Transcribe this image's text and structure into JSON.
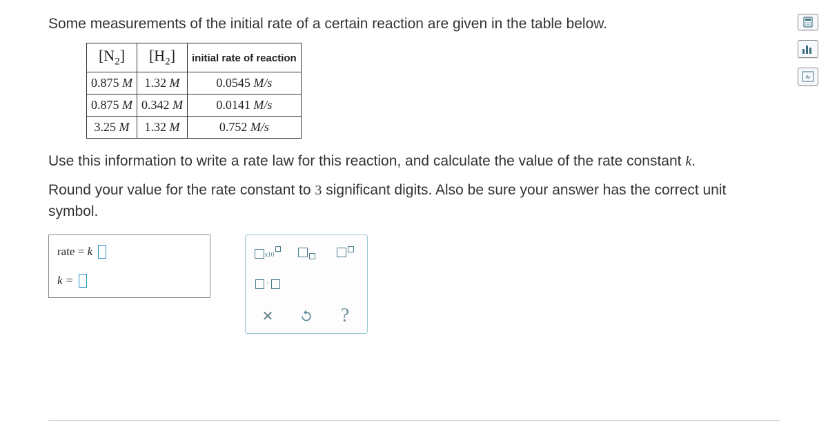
{
  "intro_text": "Some measurements of the initial rate of a certain reaction are given in the table below.",
  "table": {
    "headers": {
      "col1_element": "N",
      "col1_sub": "2",
      "col2_element": "H",
      "col2_sub": "2",
      "col3": "initial rate of reaction"
    },
    "rows": [
      {
        "n2": "0.875",
        "h2": "1.32",
        "rate": "0.0545",
        "unit_m": "M",
        "rate_unit": "M/s"
      },
      {
        "n2": "0.875",
        "h2": "0.342",
        "rate": "0.0141",
        "unit_m": "M",
        "rate_unit": "M/s"
      },
      {
        "n2": "3.25",
        "h2": "1.32",
        "rate": "0.752",
        "unit_m": "M",
        "rate_unit": "M/s"
      }
    ]
  },
  "question1_pre": "Use this information to write a rate law for this reaction, and calculate the value of the rate constant ",
  "question1_var": "k",
  "question1_post": ".",
  "question2_pre": "Round your value for the rate constant to ",
  "question2_num": "3",
  "question2_post": " significant digits. Also be sure your answer has the correct unit symbol.",
  "answer": {
    "rate_label_pre": "rate = ",
    "rate_label_var": "k",
    "k_label": "k ="
  },
  "tools": {
    "clear": "✕",
    "help": "?"
  }
}
